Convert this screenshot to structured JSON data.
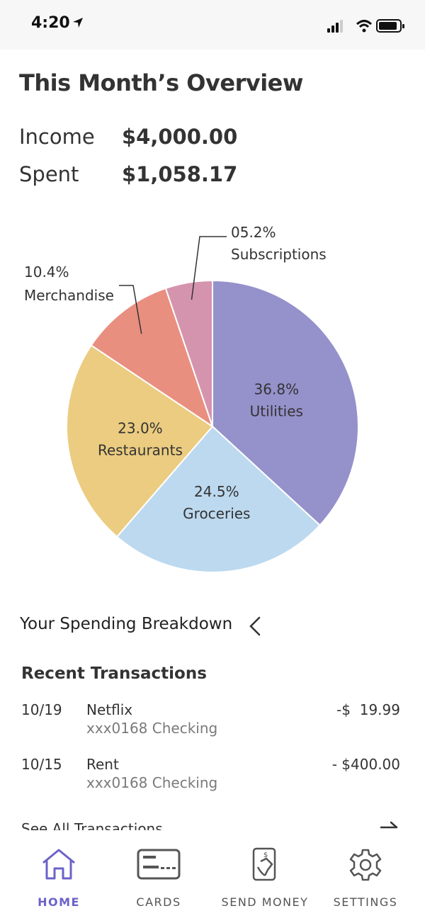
{
  "status_bar": {
    "time": "4:20"
  },
  "overview": {
    "title": "This Month’s Overview",
    "income_label": "Income",
    "income_value": "$4,000.00",
    "spent_label": "Spent",
    "spent_value": "$1,058.17"
  },
  "chart_data": {
    "type": "pie",
    "slices": [
      {
        "label": "Utilities",
        "percent_label": "36.8%",
        "value": 36.8,
        "color": "#9591cb"
      },
      {
        "label": "Groceries",
        "percent_label": "24.5%",
        "value": 24.5,
        "color": "#bcd9ef"
      },
      {
        "label": "Restaurants",
        "percent_label": "23.0%",
        "value": 23.0,
        "color": "#ebcc80"
      },
      {
        "label": "Merchandise",
        "percent_label": "10.4%",
        "value": 10.4,
        "color": "#e98f80"
      },
      {
        "label": "Subscriptions",
        "percent_label": "05.2%",
        "value": 5.2,
        "color": "#d594ad"
      }
    ]
  },
  "breakdown": {
    "label": "Your Spending Breakdown"
  },
  "transactions": {
    "title": "Recent Transactions",
    "items": [
      {
        "date": "10/19",
        "name": "Netflix",
        "account": "xxx0168 Checking",
        "amount": "-$  19.99"
      },
      {
        "date": "10/15",
        "name": "Rent",
        "account": "xxx0168 Checking",
        "amount": "- $400.00"
      }
    ],
    "see_all": "See All Transactions"
  },
  "tabbar": {
    "tabs": [
      {
        "label": "HOME",
        "icon": "home-icon",
        "active": true
      },
      {
        "label": "CARDS",
        "icon": "card-icon",
        "active": false
      },
      {
        "label": "SEND MONEY",
        "icon": "send-money-icon",
        "active": false
      },
      {
        "label": "SETTINGS",
        "icon": "gear-icon",
        "active": false
      }
    ],
    "active_color": "#6b63c9"
  }
}
